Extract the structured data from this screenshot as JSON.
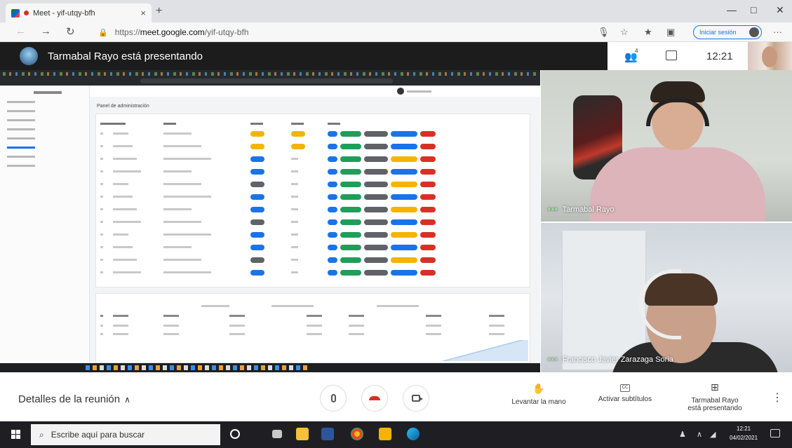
{
  "browser": {
    "tab_title": "Meet - yif-utqy-bfh",
    "tab_close": "×",
    "new_tab": "+",
    "url_prefix": "https://",
    "url_domain": "meet.google.com",
    "url_path": "/yif-utqy-bfh",
    "signin_label": "Iniciar sesión",
    "win_minimize": "—",
    "win_maximize": "□",
    "win_close": "✕"
  },
  "meet": {
    "presenter_title": "Tarmabal Rayo está presentando",
    "people_count": "4",
    "clock": "12:21"
  },
  "shared_screen": {
    "heading": "Panel de administración"
  },
  "participants": [
    {
      "name": "Tarmabal Rayo"
    },
    {
      "name": "Francisco Javier Zarazaga Soria"
    }
  ],
  "controls": {
    "meeting_details": "Detalles de la reunión",
    "raise_hand": "Levantar la mano",
    "captions": "Activar subtítulos",
    "captions_icon_text": "CC",
    "presenting_line1": "Tarmabal Rayo",
    "presenting_line2": "está presentando"
  },
  "taskbar": {
    "search_placeholder": "Escribe aquí para buscar",
    "time": "12:21",
    "date": "04/02/2021"
  },
  "colors": {
    "meet_dark": "#1c1c1c",
    "hangup_red": "#d93025",
    "accent_blue": "#1a73e8",
    "taskbar": "#1f1f23"
  },
  "icons": [
    "favicon-icon",
    "recording-icon",
    "back-icon",
    "forward-icon",
    "reload-icon",
    "lock-icon",
    "people-icon",
    "chat-icon",
    "mic-icon",
    "hangup-icon",
    "camera-icon",
    "raise-hand-icon",
    "captions-icon",
    "present-icon",
    "more-options-icon",
    "windows-start-icon",
    "search-icon",
    "notification-icon"
  ]
}
